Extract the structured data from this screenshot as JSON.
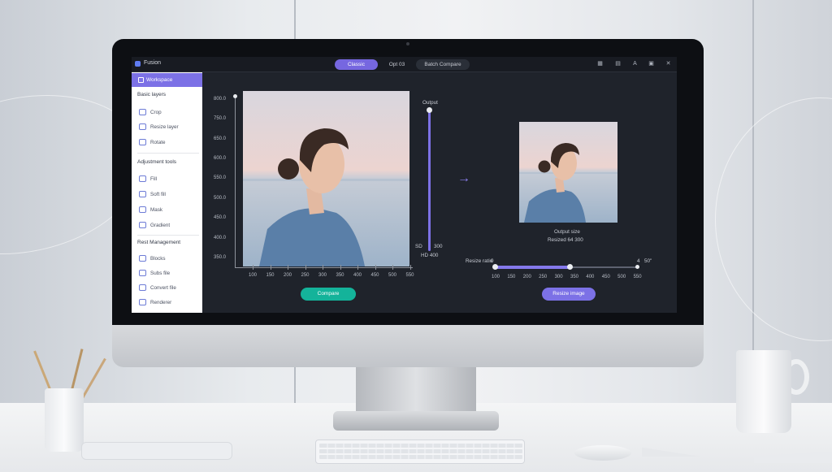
{
  "app": {
    "name": "Fusion"
  },
  "tabs": [
    {
      "label": "Classic",
      "active": true
    },
    {
      "label": "Opt 03"
    },
    {
      "label": "Batch Compare"
    }
  ],
  "toolbar_icons": [
    "grid-icon",
    "layers-icon",
    "text-icon",
    "grid-alt-icon",
    "close-icon"
  ],
  "sidebar": {
    "header": "Workspace",
    "sections": [
      {
        "title": "Basic layers",
        "items": [
          "Crop",
          "Resize layer",
          "Rotate"
        ]
      },
      {
        "title": "Adjustment tools",
        "items": [
          "Fill",
          "Soft fill",
          "Mask",
          "Gradient"
        ]
      },
      {
        "title": "Rest Management",
        "items": [
          "Blocks",
          "Subs file",
          "Convert file",
          "Renderer"
        ]
      }
    ]
  },
  "left_chart": {
    "y_labels": [
      "800.0",
      "750.0",
      "650.0",
      "600.0",
      "550.0",
      "500.0",
      "450.0",
      "400.0",
      "350.0"
    ],
    "x_labels": [
      "100",
      "150",
      "200",
      "250",
      "300",
      "350",
      "400",
      "450",
      "500",
      "550"
    ]
  },
  "vertical_slider": {
    "top_label": "Output",
    "bottom_labels": [
      "SD",
      "300",
      "HD 400"
    ],
    "value": 0.95
  },
  "preview": {
    "caption_line1": "Output size",
    "caption_line2": "Resized 64 300"
  },
  "horizontal_slider": {
    "left_label": "Resize ratio",
    "left_value": "0",
    "right_label": "4",
    "right_value": "50\"",
    "fill": 0.52,
    "x_labels": [
      "100",
      "150",
      "200",
      "250",
      "300",
      "350",
      "400",
      "450",
      "500",
      "550"
    ]
  },
  "buttons": {
    "left": "Compare",
    "right": "Resize image"
  },
  "colors": {
    "accent": "#7c71e6",
    "teal": "#14b39a",
    "screen_bg": "#1f232b"
  }
}
